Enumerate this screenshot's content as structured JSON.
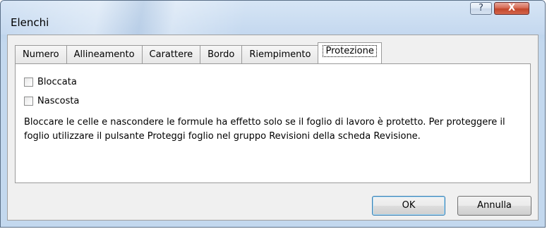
{
  "window": {
    "title": "Elenchi",
    "help_glyph": "?",
    "close_glyph": "X"
  },
  "tabs": [
    {
      "label": "Numero",
      "active": false
    },
    {
      "label": "Allineamento",
      "active": false
    },
    {
      "label": "Carattere",
      "active": false
    },
    {
      "label": "Bordo",
      "active": false
    },
    {
      "label": "Riempimento",
      "active": false
    },
    {
      "label": "Protezione",
      "active": true
    }
  ],
  "protection": {
    "locked": {
      "label": "Bloccata",
      "checked": false
    },
    "hidden": {
      "label": "Nascosta",
      "checked": false
    },
    "description": "Bloccare le celle e nascondere le formule ha effetto solo se il foglio di lavoro è protetto. Per proteggere il foglio utilizzare il pulsante Proteggi foglio nel gruppo Revisioni della scheda Revisione."
  },
  "buttons": {
    "ok": "OK",
    "cancel": "Annulla"
  }
}
